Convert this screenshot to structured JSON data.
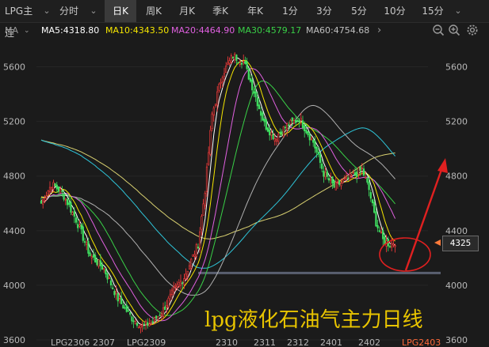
{
  "toolbar": {
    "symbol": "LPG主连",
    "periods": [
      "分时",
      "日K",
      "周K",
      "月K",
      "季K",
      "年K",
      "1分",
      "3分",
      "5分",
      "10分",
      "15分"
    ],
    "active_period": "日K"
  },
  "ma_bar": {
    "toggle": "MA",
    "ma5": "MA5:4318.80",
    "ma10": "MA10:4343.50",
    "ma20": "MA20:4464.90",
    "ma30": "MA30:4579.17",
    "ma60": "MA60:4754.68"
  },
  "colors": {
    "ma5": "#ffffff",
    "ma10": "#f5e600",
    "ma20": "#e060e0",
    "ma30": "#39d047",
    "ma60": "#b0b0b0",
    "long_ma": "#2ec4d8",
    "slow_ma": "#d8d070",
    "up": "#ff3b3b",
    "down": "#3fe060",
    "annotation": "#e02020",
    "caption": "#e8c400"
  },
  "price_tag": "4325",
  "caption": "lpg液化石油气主力日线",
  "chart_data": {
    "type": "candlestick",
    "ylim": [
      3600,
      5800
    ],
    "y_ticks": [
      3600,
      4000,
      4400,
      4800,
      5200,
      5600
    ],
    "x_labels": [
      "LPG2306",
      "2307",
      "LPG2309",
      "2310",
      "2311",
      "2312",
      "2401",
      "2402",
      "LPG2403"
    ],
    "price_path": [
      [
        0,
        4600
      ],
      [
        6,
        4740
      ],
      [
        12,
        4680
      ],
      [
        20,
        4480
      ],
      [
        28,
        4220
      ],
      [
        36,
        4120
      ],
      [
        44,
        3900
      ],
      [
        52,
        3760
      ],
      [
        58,
        3700
      ],
      [
        64,
        3730
      ],
      [
        70,
        3820
      ],
      [
        76,
        3960
      ],
      [
        82,
        4060
      ],
      [
        90,
        4300
      ],
      [
        94,
        4700
      ],
      [
        98,
        5250
      ],
      [
        104,
        5550
      ],
      [
        110,
        5680
      ],
      [
        116,
        5640
      ],
      [
        122,
        5420
      ],
      [
        128,
        5180
      ],
      [
        134,
        5080
      ],
      [
        140,
        5160
      ],
      [
        148,
        5220
      ],
      [
        156,
        5050
      ],
      [
        162,
        4820
      ],
      [
        168,
        4720
      ],
      [
        176,
        4780
      ],
      [
        184,
        4850
      ],
      [
        188,
        4700
      ],
      [
        192,
        4460
      ],
      [
        196,
        4330
      ],
      [
        200,
        4300
      ],
      [
        203,
        4320
      ]
    ],
    "series": [
      {
        "name": "MA5",
        "last": 4318.8
      },
      {
        "name": "MA10",
        "last": 4343.5
      },
      {
        "name": "MA20",
        "last": 4464.9
      },
      {
        "name": "MA30",
        "last": 4579.17
      },
      {
        "name": "MA60",
        "last": 4754.68
      }
    ],
    "support_level": 4090,
    "annotation": "circled last price with red arrow pointing up"
  }
}
